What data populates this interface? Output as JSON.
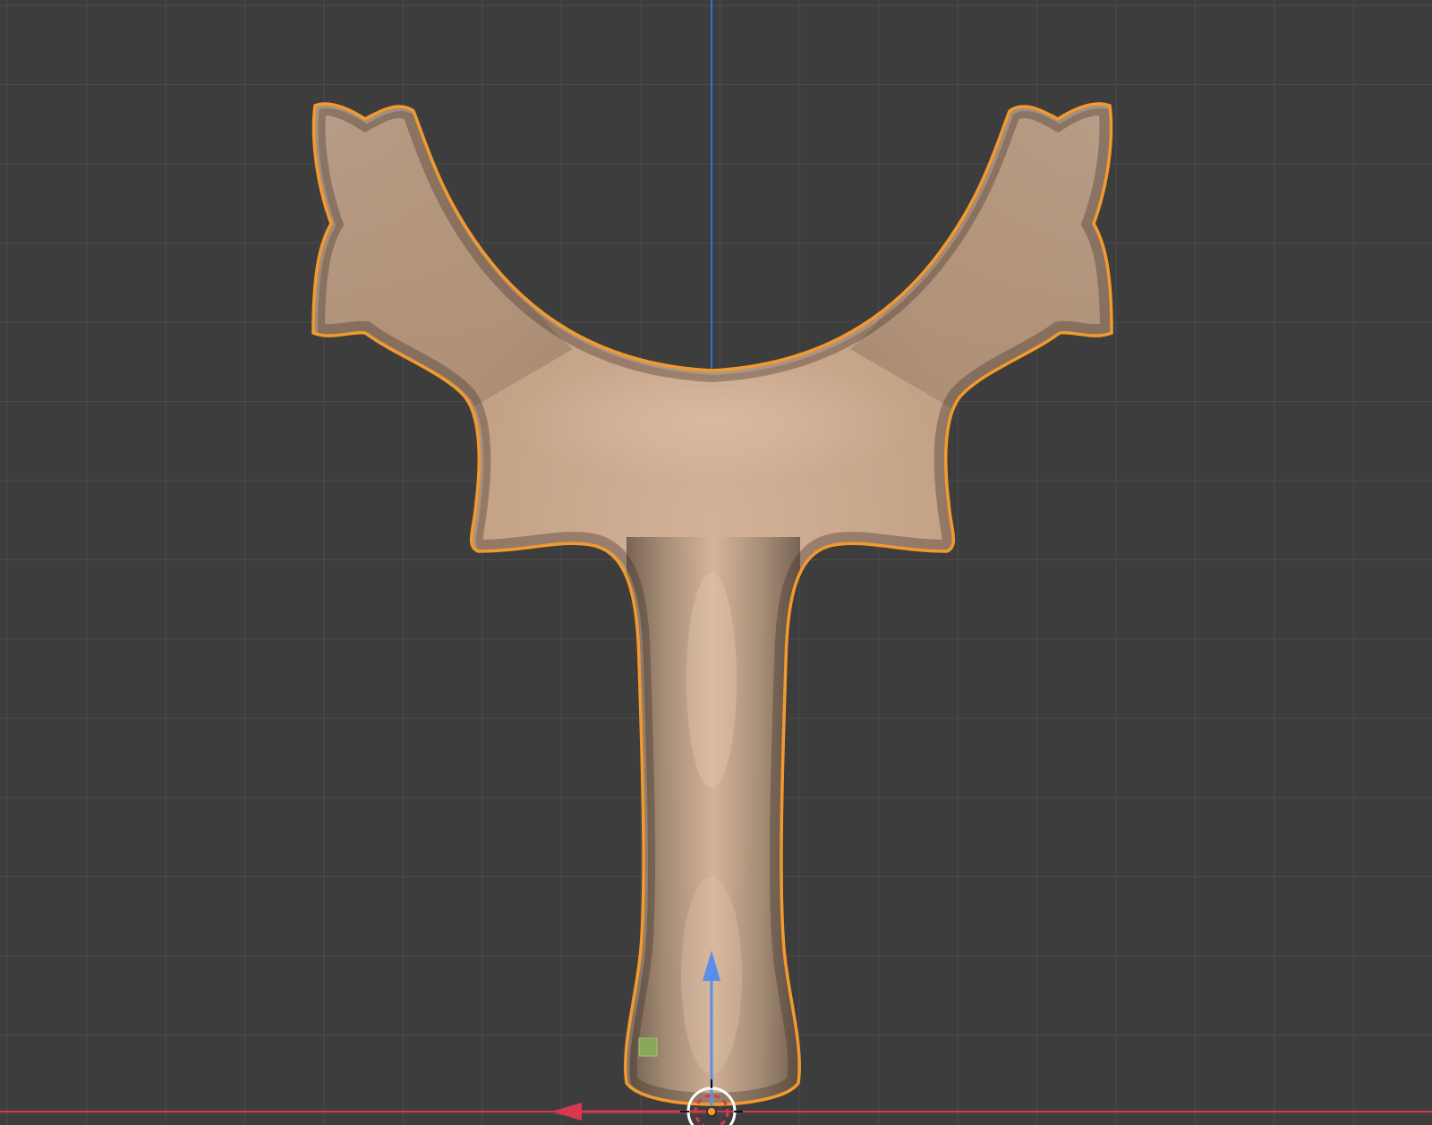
{
  "viewport": {
    "view": "front-orthographic",
    "background_color": "#3d3d3d",
    "grid": true,
    "grid_color": "#4a4a4a",
    "axis_x_color": "#d8384e",
    "axis_z_color": "#2f73c9",
    "selection_outline_color": "#f39a2e"
  },
  "object": {
    "name": "",
    "shape": "slingshot-frame",
    "material_color": "#c9a88c",
    "selected": true
  },
  "gizmos": {
    "object_origin": {
      "icon": "object-origin-dot",
      "color": "#f39a2e"
    },
    "cursor_3d": {
      "icon": "3d-cursor-icon"
    },
    "translate_z": {
      "icon": "arrow-up-icon",
      "color": "#5a8ee8"
    },
    "translate_x": {
      "icon": "arrow-left-icon",
      "color": "#d8384e"
    },
    "plane_handle": {
      "icon": "plane-handle-icon",
      "color": "#8aa85a"
    }
  }
}
